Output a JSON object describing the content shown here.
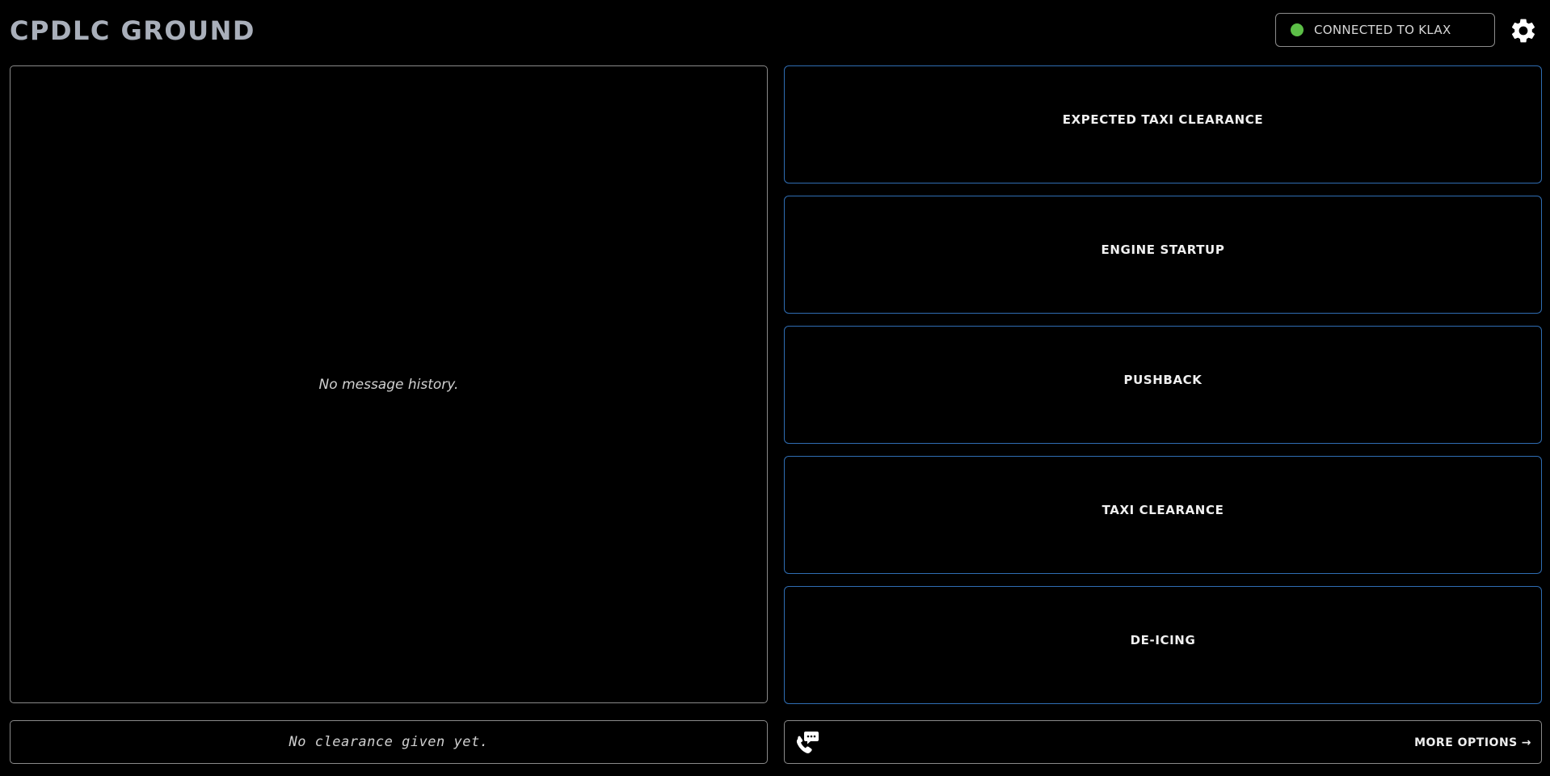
{
  "header": {
    "title": "CPDLC GROUND",
    "connection_status": "CONNECTED TO KLAX",
    "connection_color": "#5cbf47",
    "settings_icon": "gear-icon"
  },
  "history": {
    "empty_text": "No message history."
  },
  "actions": [
    {
      "label": "EXPECTED TAXI CLEARANCE"
    },
    {
      "label": "ENGINE STARTUP"
    },
    {
      "label": "PUSHBACK"
    },
    {
      "label": "TAXI CLEARANCE"
    },
    {
      "label": "DE-ICING"
    }
  ],
  "clearance": {
    "empty_text": "No clearance given yet."
  },
  "footer": {
    "phone_icon": "phone-message-icon",
    "more_options": "MORE OPTIONS",
    "more_options_arrow": "→"
  },
  "colors": {
    "background": "#000000",
    "action_border": "#2f6db3",
    "title": "#a9afba"
  }
}
